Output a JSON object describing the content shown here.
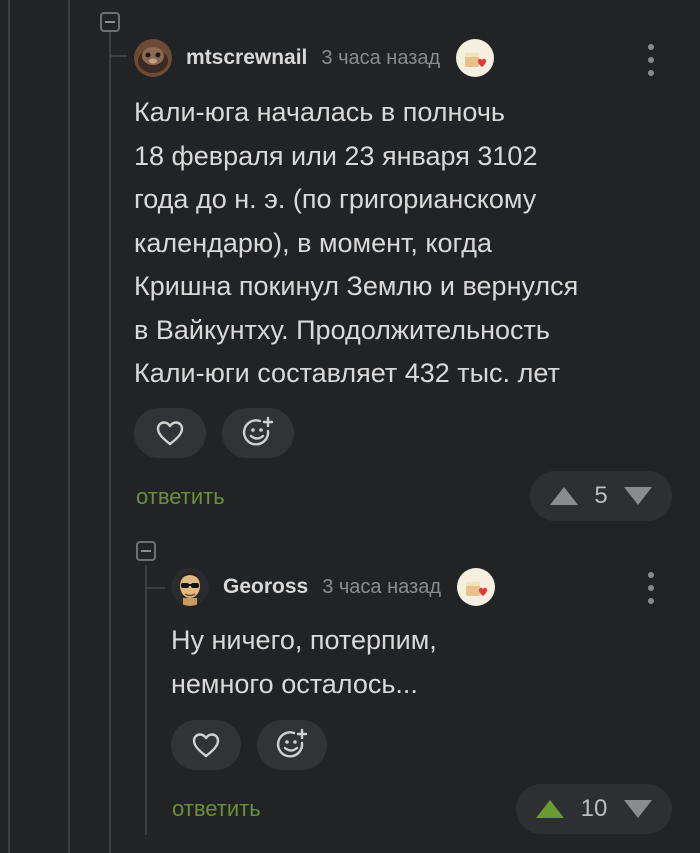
{
  "comment1": {
    "author": "mtscrewnail",
    "time": "3 часа назад",
    "text": "Кали-юга началась в полночь\n18 февраля или 23 января 3102\nгода до н. э. (по григорианскому\nкалендарю), в момент, когда\nКришна покинул Землю и вернулся\nв Вайкунтху. Продолжительность\nКали-юги составляет 432 тыс. лет",
    "reply_label": "ответить",
    "rating": "5",
    "upvote_color": "#8a8b8e"
  },
  "comment2": {
    "author": "Geoross",
    "time": "3 часа назад",
    "text": "Ну ничего, потерпим,\nнемного осталось...",
    "reply_label": "ответить",
    "rating": "10",
    "upvote_color": "#6c9a32"
  },
  "icons": {
    "like": "heart-outline",
    "reaction": "smiley-plus",
    "menu": "vertical-dots",
    "award": "cake-heart-award",
    "upvote": "triangle-up",
    "downvote": "triangle-down",
    "collapse": "minus-square"
  },
  "colors": {
    "background": "#222325",
    "reply_link": "#6c8f3a",
    "pill": "#323336"
  }
}
